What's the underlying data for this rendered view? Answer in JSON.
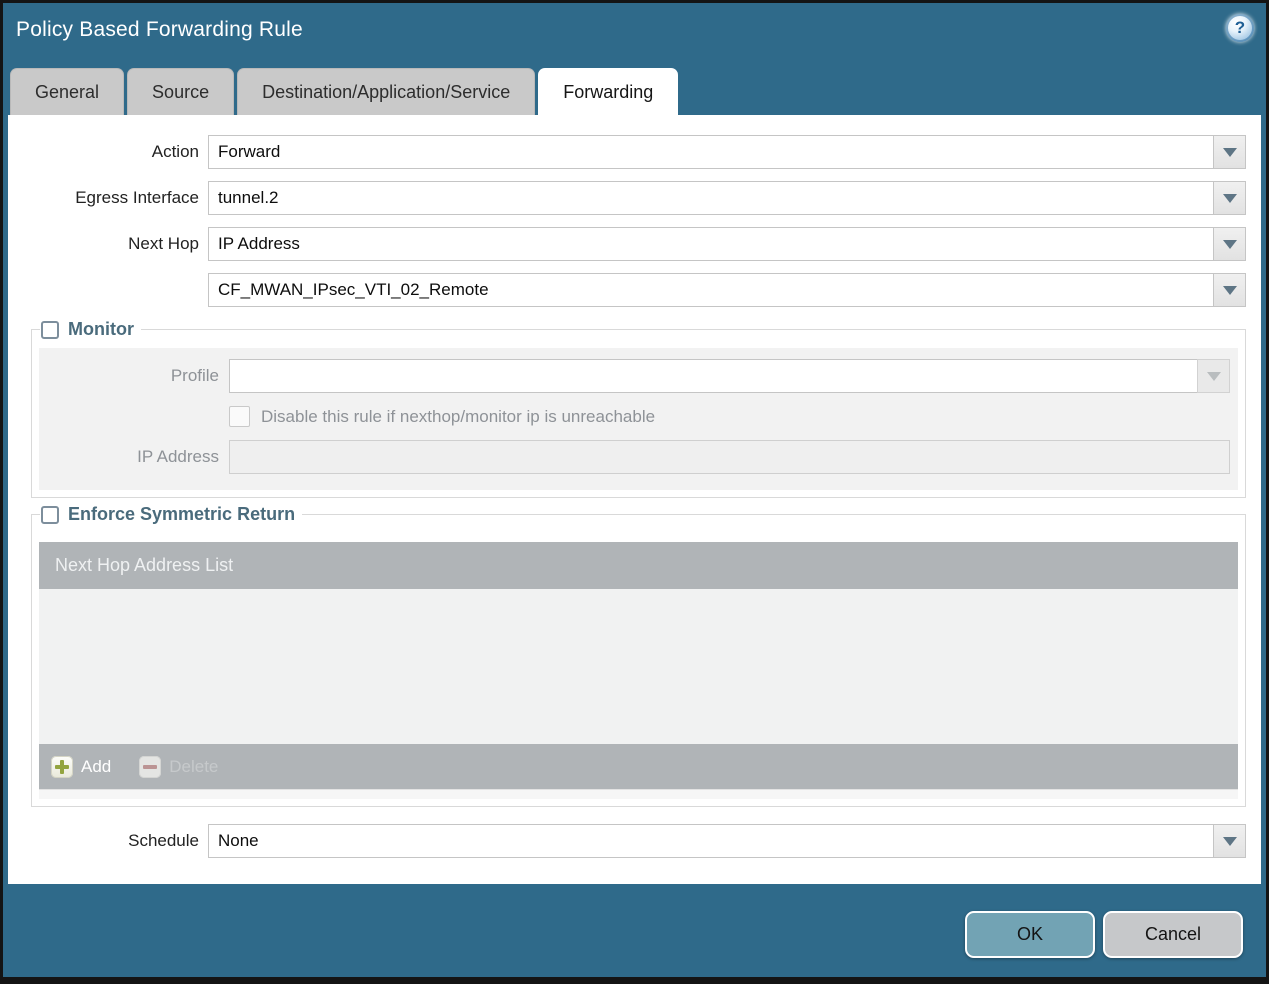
{
  "window": {
    "title": "Policy Based Forwarding Rule"
  },
  "help": {
    "glyph": "?"
  },
  "tabs": [
    {
      "label": "General",
      "active": false
    },
    {
      "label": "Source",
      "active": false
    },
    {
      "label": "Destination/Application/Service",
      "active": false
    },
    {
      "label": "Forwarding",
      "active": true
    }
  ],
  "form": {
    "action": {
      "label": "Action",
      "value": "Forward"
    },
    "egress_interface": {
      "label": "Egress Interface",
      "value": "tunnel.2"
    },
    "next_hop": {
      "label": "Next Hop",
      "value": "IP Address"
    },
    "next_hop_address": {
      "value": "CF_MWAN_IPsec_VTI_02_Remote"
    },
    "schedule": {
      "label": "Schedule",
      "value": "None"
    }
  },
  "monitor": {
    "title": "Monitor",
    "checked": false,
    "profile": {
      "label": "Profile",
      "value": ""
    },
    "disable_rule": {
      "label": "Disable this rule if nexthop/monitor ip is unreachable",
      "checked": false
    },
    "ip_address": {
      "label": "IP Address",
      "value": ""
    }
  },
  "symmetric_return": {
    "title": "Enforce Symmetric Return",
    "checked": false,
    "list_header": "Next Hop Address List",
    "rows": [],
    "add_label": "Add",
    "delete_label": "Delete"
  },
  "footer": {
    "ok_label": "OK",
    "cancel_label": "Cancel"
  },
  "colors": {
    "titlebar_teal": "#2F6A8A",
    "tab_inactive_gray": "#C9C9C9",
    "section_title_blue": "#4A6B7C",
    "disabled_field_beige": "#F0ECDC",
    "grid_bar_gray": "#B0B4B7",
    "ok_button_teal": "#72A3B4",
    "cancel_button_gray": "#C6C8CA",
    "add_icon_green": "#93A43F",
    "delete_icon_red": "#BB9494"
  }
}
